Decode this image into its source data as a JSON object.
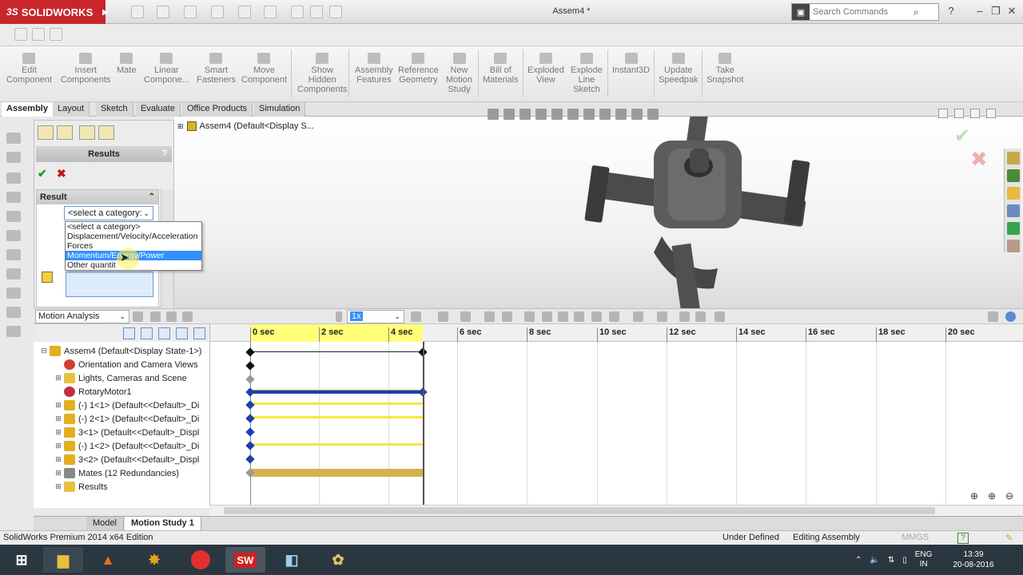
{
  "app": {
    "brand": "SOLIDWORKS",
    "document_title": "Assem4 *"
  },
  "search": {
    "placeholder": "Search Commands"
  },
  "command_manager": {
    "items": [
      {
        "label": "Edit\nComponent"
      },
      {
        "label": "Insert\nComponents"
      },
      {
        "label": "Mate"
      },
      {
        "label": "Linear\nCompone..."
      },
      {
        "label": "Smart\nFasteners"
      },
      {
        "label": "Move\nComponent"
      },
      {
        "label": "Show\nHidden\nComponents"
      },
      {
        "label": "Assembly\nFeatures"
      },
      {
        "label": "Reference\nGeometry"
      },
      {
        "label": "New\nMotion\nStudy"
      },
      {
        "label": "Bill of\nMaterials"
      },
      {
        "label": "Exploded\nView"
      },
      {
        "label": "Explode\nLine\nSketch"
      },
      {
        "label": "Instant3D"
      },
      {
        "label": "Update\nSpeedpak"
      },
      {
        "label": "Take\nSnapshot"
      }
    ]
  },
  "tabs": [
    "Assembly",
    "Layout",
    "Sketch",
    "Evaluate",
    "Office Products",
    "Simulation"
  ],
  "property_manager": {
    "title": "Results",
    "group_title": "Result",
    "category_select": "<select a category:",
    "category_options": [
      "<select a category>",
      "Displacement/Velocity/Acceleration",
      "Forces",
      "Momentum/Energy/Power",
      "Other quantit"
    ],
    "selected_option": "Momentum/Energy/Power"
  },
  "graphics": {
    "feature_tree_root": "Assem4 (Default<Display S..."
  },
  "motion_manager": {
    "study_type": "Motion Analysis",
    "speed": "1x",
    "tree": [
      {
        "label": "Assem4  (Default<Display State-1>)",
        "icon": "assembly-icon",
        "color": "#e0b020"
      },
      {
        "label": "Orientation and Camera Views",
        "icon": "camera-icon",
        "color": "#d04030"
      },
      {
        "label": "Lights, Cameras and Scene",
        "icon": "lights-folder-icon",
        "color": "#e8c040"
      },
      {
        "label": "RotaryMotor1",
        "icon": "motor-icon",
        "color": "#c03040"
      },
      {
        "label": "(-) 1<1> (Default<<Default>_Di",
        "icon": "part-icon",
        "color": "#e0b020"
      },
      {
        "label": "(-) 2<1> (Default<<Default>_Di",
        "icon": "part-icon",
        "color": "#e0b020"
      },
      {
        "label": "3<1> (Default<<Default>_Displ",
        "icon": "part-icon",
        "color": "#e0b020"
      },
      {
        "label": "(-) 1<2> (Default<<Default>_Di",
        "icon": "part-icon",
        "color": "#e0b020"
      },
      {
        "label": "3<2> (Default<<Default>_Displ",
        "icon": "part-icon",
        "color": "#e0b020"
      },
      {
        "label": "Mates (12 Redundancies)",
        "icon": "mates-icon",
        "color": "#888888"
      },
      {
        "label": "Results",
        "icon": "results-folder-icon",
        "color": "#e8c040"
      }
    ],
    "time_ticks": [
      "0 sec",
      "2 sec",
      "4 sec",
      "6 sec",
      "8 sec",
      "10 sec",
      "12 sec",
      "14 sec",
      "16 sec",
      "18 sec",
      "20 sec"
    ],
    "current_time_sec": 5,
    "bottom_tabs": [
      "Model",
      "Motion Study 1"
    ]
  },
  "status": {
    "edition": "SolidWorks Premium 2014 x64 Edition",
    "state": "Under Defined",
    "mode": "Editing Assembly",
    "units": "MMGS"
  },
  "taskbar": {
    "lang": "ENG\nIN",
    "time": "13:39",
    "date": "20-08-2016"
  }
}
